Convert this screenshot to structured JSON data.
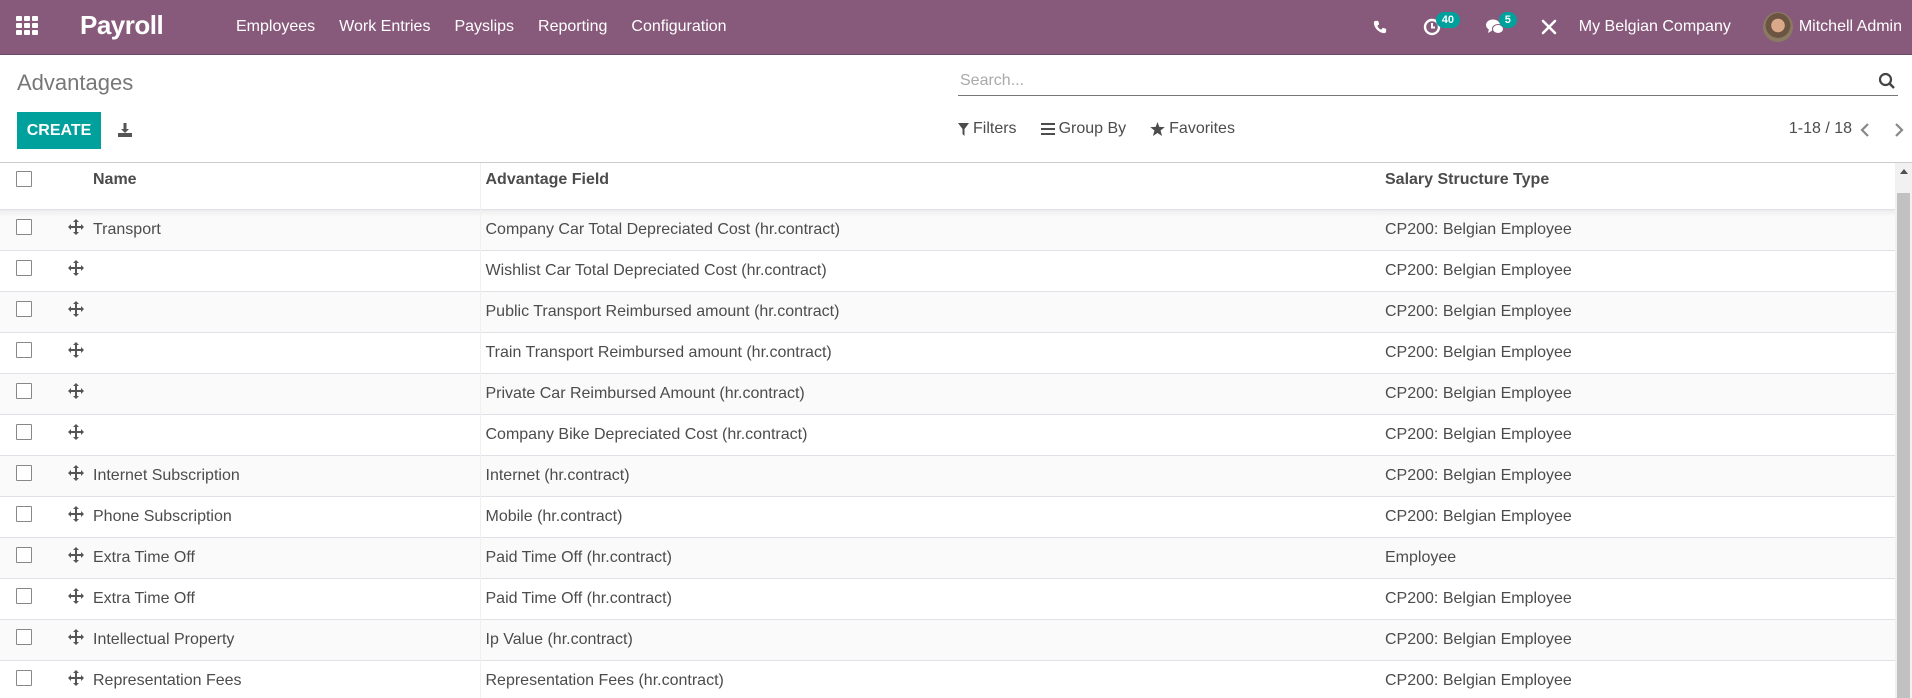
{
  "navbar": {
    "app_name": "Payroll",
    "menu": [
      "Employees",
      "Work Entries",
      "Payslips",
      "Reporting",
      "Configuration"
    ],
    "activity_count": "40",
    "messages_count": "5",
    "company": "My Belgian Company",
    "user": "Mitchell Admin",
    "brand_color": "#875a7b"
  },
  "control_panel": {
    "breadcrumb": "Advantages",
    "create_label": "CREATE",
    "search_placeholder": "Search...",
    "filters_label": "Filters",
    "group_by_label": "Group By",
    "favorites_label": "Favorites",
    "pager": "1-18 / 18",
    "accent_color": "#00a09d"
  },
  "table": {
    "columns": [
      "Name",
      "Advantage Field",
      "Salary Structure Type"
    ],
    "rows": [
      {
        "name": "Transport",
        "field": "Company Car Total Depreciated Cost (hr.contract)",
        "sst": "CP200: Belgian Employee"
      },
      {
        "name": "",
        "field": "Wishlist Car Total Depreciated Cost (hr.contract)",
        "sst": "CP200: Belgian Employee"
      },
      {
        "name": "",
        "field": "Public Transport Reimbursed amount (hr.contract)",
        "sst": "CP200: Belgian Employee"
      },
      {
        "name": "",
        "field": "Train Transport Reimbursed amount (hr.contract)",
        "sst": "CP200: Belgian Employee"
      },
      {
        "name": "",
        "field": "Private Car Reimbursed Amount (hr.contract)",
        "sst": "CP200: Belgian Employee"
      },
      {
        "name": "",
        "field": "Company Bike Depreciated Cost (hr.contract)",
        "sst": "CP200: Belgian Employee"
      },
      {
        "name": "Internet Subscription",
        "field": "Internet (hr.contract)",
        "sst": "CP200: Belgian Employee"
      },
      {
        "name": "Phone Subscription",
        "field": "Mobile (hr.contract)",
        "sst": "CP200: Belgian Employee"
      },
      {
        "name": "Extra Time Off",
        "field": "Paid Time Off (hr.contract)",
        "sst": "Employee"
      },
      {
        "name": "Extra Time Off",
        "field": "Paid Time Off (hr.contract)",
        "sst": "CP200: Belgian Employee"
      },
      {
        "name": "Intellectual Property",
        "field": "Ip Value (hr.contract)",
        "sst": "CP200: Belgian Employee"
      },
      {
        "name": "Representation Fees",
        "field": "Representation Fees (hr.contract)",
        "sst": "CP200: Belgian Employee"
      }
    ]
  }
}
